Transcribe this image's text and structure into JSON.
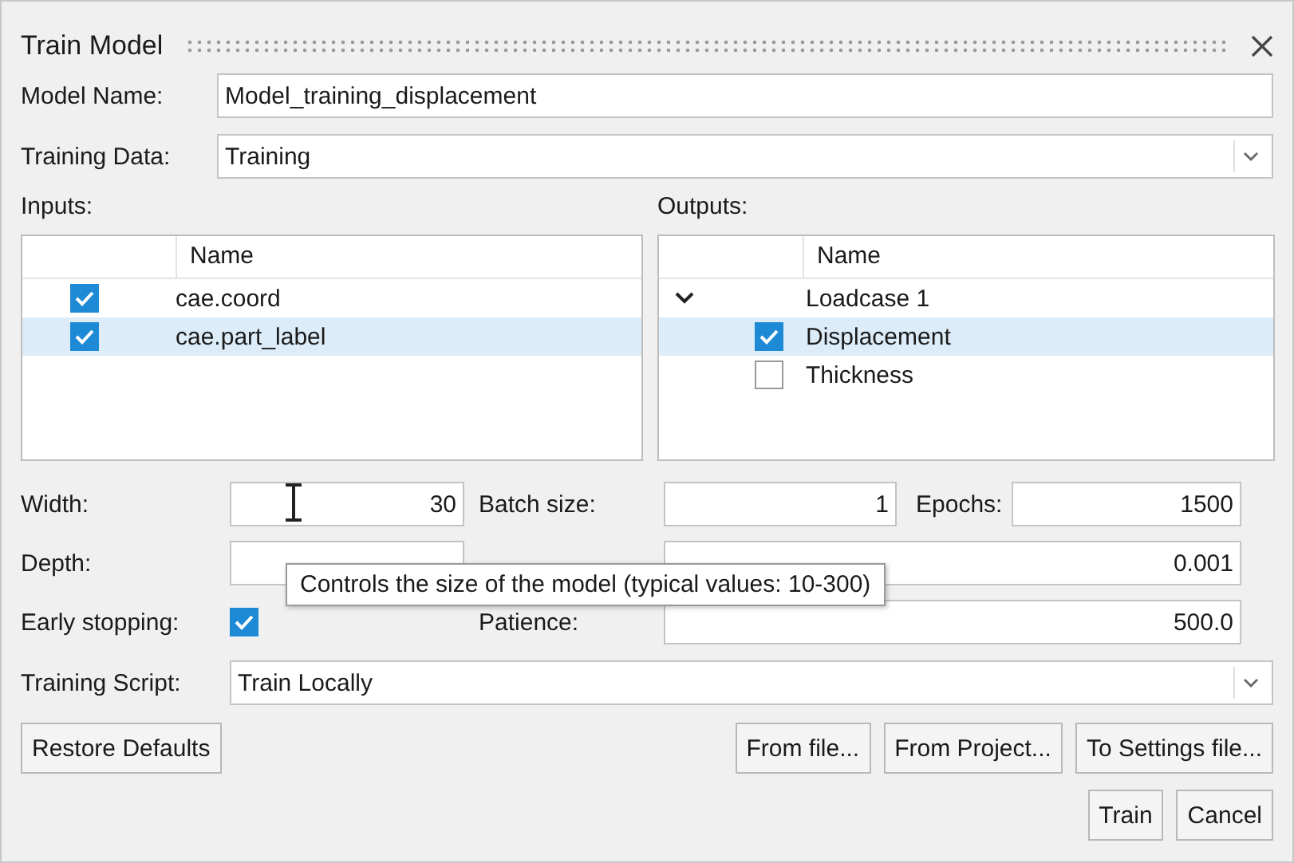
{
  "window": {
    "title": "Train Model"
  },
  "model_name": {
    "label": "Model Name:",
    "value": "Model_training_displacement"
  },
  "training_data": {
    "label": "Training Data:",
    "value": "Training"
  },
  "inputs": {
    "label": "Inputs:",
    "column": "Name",
    "items": [
      {
        "name": "cae.coord",
        "checked": true,
        "selected": false
      },
      {
        "name": "cae.part_label",
        "checked": true,
        "selected": true
      }
    ]
  },
  "outputs": {
    "label": "Outputs:",
    "column": "Name",
    "items": [
      {
        "name": "Loadcase 1",
        "expanded": true,
        "children": [
          {
            "name": "Displacement",
            "checked": true,
            "selected": true
          },
          {
            "name": "Thickness",
            "checked": false,
            "selected": false
          }
        ]
      }
    ]
  },
  "width": {
    "label": "Width:",
    "value": "30"
  },
  "batch_size": {
    "label": "Batch size:",
    "value": "1"
  },
  "epochs": {
    "label": "Epochs:",
    "value": "1500"
  },
  "depth": {
    "label": "Depth:"
  },
  "learning_rate": {
    "value": "0.001"
  },
  "early_stopping": {
    "label": "Early stopping:",
    "checked": true
  },
  "patience": {
    "label": "Patience:",
    "value": "500.0"
  },
  "tooltip": {
    "text": "Controls the size of the model (typical values: 10-300)"
  },
  "training_script": {
    "label": "Training Script:",
    "value": "Train Locally"
  },
  "buttons": {
    "left": [
      "Restore Defaults"
    ],
    "right": [
      "From file...",
      "From Project...",
      "To Settings file..."
    ],
    "footer": [
      "Train",
      "Cancel"
    ]
  }
}
